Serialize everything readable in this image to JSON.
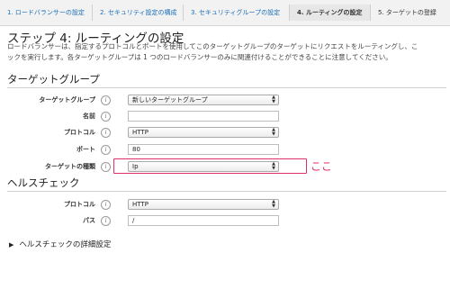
{
  "wizard": {
    "steps": [
      "1. ロードバランサーの設定",
      "2. セキュリティ設定の構成",
      "3. セキュリティグループの設定",
      "4. ルーティングの設定",
      "5. ターゲットの登録"
    ],
    "active_step": 4
  },
  "page": {
    "title": "ステップ 4: ルーティングの設定",
    "description_line1": "ロードバランサーは、指定するプロトコルとポートを使用してこのターゲットグループのターゲットにリクエストをルーティングし、こ",
    "description_line2": "ックを実行します。各ターゲットグループは 1 つのロードバランサーのみに関連付けることができることに注意してください。"
  },
  "target_group": {
    "heading": "ターゲットグループ",
    "fields": {
      "target_group_label": "ターゲットグループ",
      "target_group_value": "新しいターゲットグループ",
      "name_label": "名前",
      "name_value": "",
      "protocol_label": "プロトコル",
      "protocol_value": "HTTP",
      "port_label": "ポート",
      "port_value": "80",
      "target_type_label": "ターゲットの種類",
      "target_type_value": "Ip"
    }
  },
  "annotation": {
    "text": "ここ",
    "color": "#e0306a"
  },
  "health_check": {
    "heading": "ヘルスチェック",
    "protocol_label": "プロトコル",
    "protocol_value": "HTTP",
    "path_label": "パス",
    "path_value": "/",
    "advanced_label": "ヘルスチェックの詳細設定"
  },
  "icons": {
    "info": "info-icon",
    "select_arrows": "updown-arrows-icon",
    "disclosure": "triangle-right-icon"
  },
  "colors": {
    "link": "#1a6fb8",
    "highlight": "#e0306a"
  }
}
